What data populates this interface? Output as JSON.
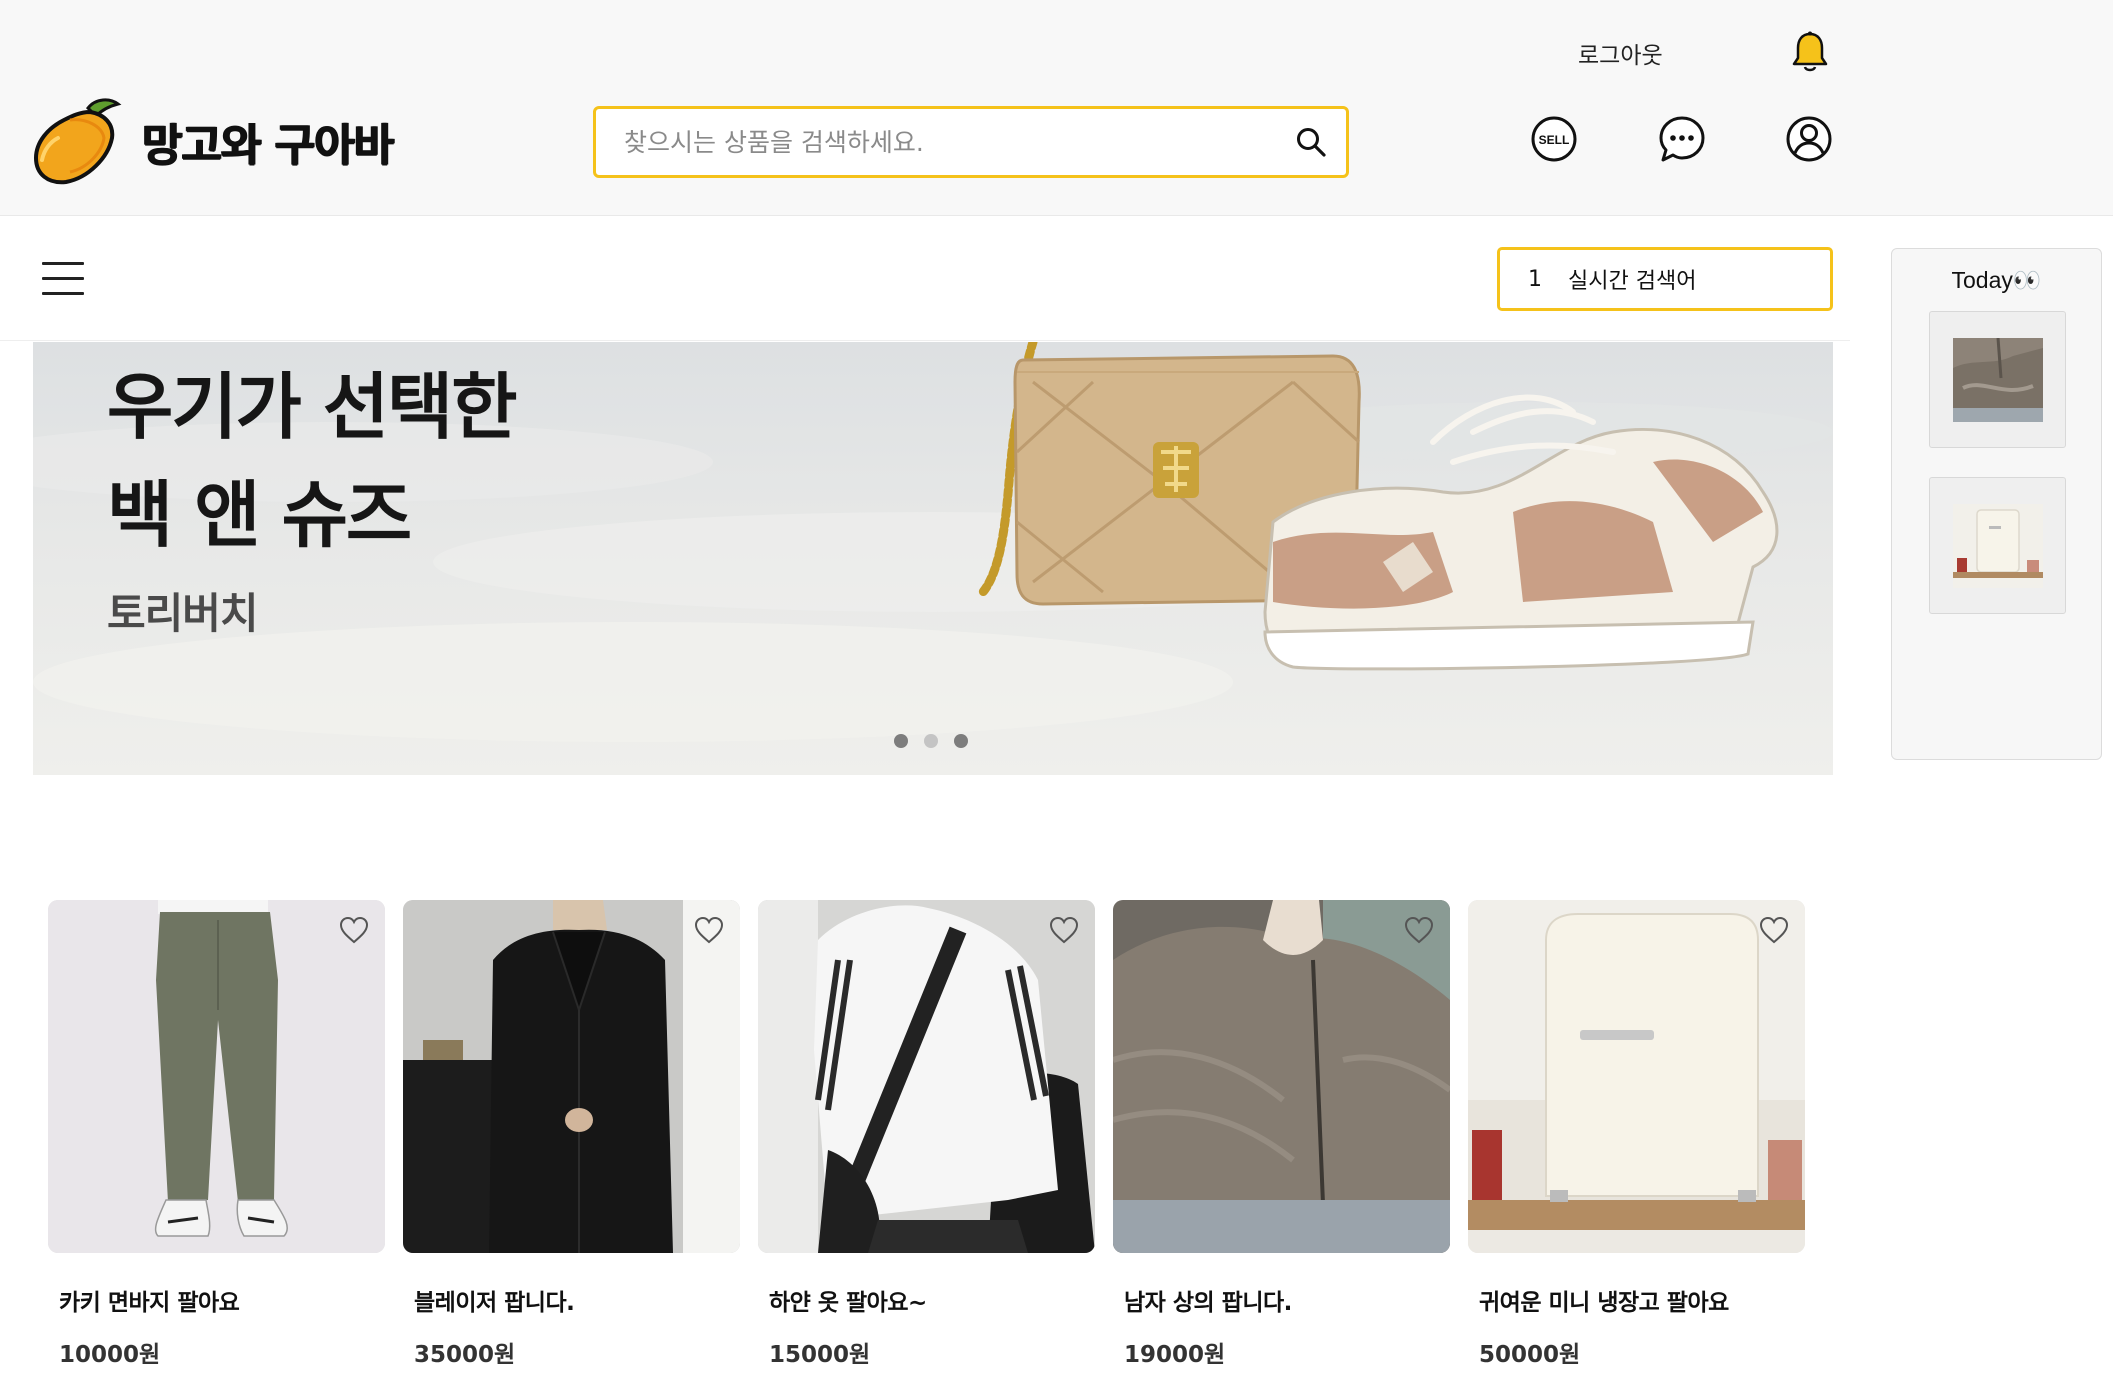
{
  "header": {
    "brand_name": "망고와 구아바",
    "search_placeholder": "찾으시는 상품을 검색하세요.",
    "logout_label": "로그아웃",
    "sell_icon_label": "SELL",
    "icons": [
      "bell-icon",
      "sell-icon",
      "chat-icon",
      "user-icon",
      "search-icon"
    ],
    "accent_color": "#f5c21a"
  },
  "subnav": {
    "realtime_rank": "1",
    "realtime_label": "실시간 검색어"
  },
  "today": {
    "title": "Today",
    "title_emoji": "👀",
    "items": [
      {
        "alt": "남자 상의"
      },
      {
        "alt": "미니 냉장고"
      }
    ]
  },
  "banner": {
    "title_line1": "우기가 선택한",
    "title_line2": "백 앤 슈즈",
    "brand": "토리버치",
    "slides": 3,
    "active_slide": 1
  },
  "products": [
    {
      "title": "카키 면바지 팔아요",
      "price": "10000원"
    },
    {
      "title": "블레이저 팝니다.",
      "price": "35000원"
    },
    {
      "title": "하얀 옷 팔아요~",
      "price": "15000원"
    },
    {
      "title": "남자 상의 팝니다.",
      "price": "19000원"
    },
    {
      "title": "귀여운 미니 냉장고 팔아요",
      "price": "50000원"
    }
  ]
}
